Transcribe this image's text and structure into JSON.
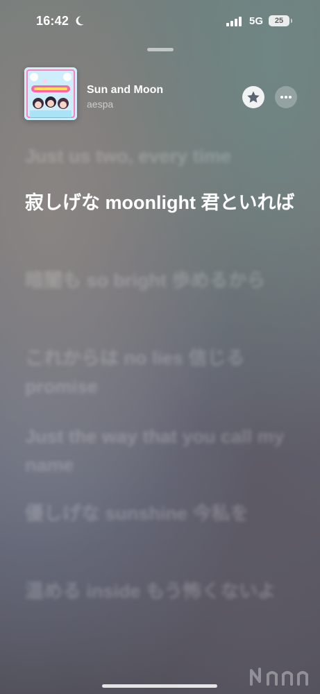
{
  "status_bar": {
    "time": "16:42",
    "time_icon": "moon-icon",
    "signal_icon": "cellular-signal-icon",
    "network": "5G",
    "battery": "25"
  },
  "now_playing": {
    "title": "Sun and Moon",
    "artist": "aespa",
    "favorite_icon": "star-icon",
    "more_icon": "more-icon"
  },
  "lyrics": {
    "previous": "Just us two, every time",
    "current": "寂しげな moonlight 君といれば",
    "upcoming": [
      "暗闇も so bright 歩めるから",
      "これからは no lies 信じる promise",
      "Just the way that you call my name",
      "優しげな sunshine 今私を",
      "温める inside もう怖くないよ"
    ]
  },
  "colors": {
    "text_primary": "#ffffff",
    "text_secondary": "rgba(255,255,255,0.6)"
  }
}
